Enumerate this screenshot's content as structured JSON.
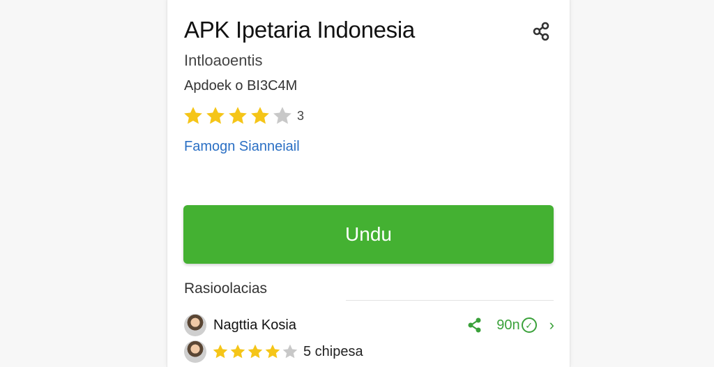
{
  "app": {
    "title": "APK Ipetaria Indonesia",
    "subtitle": "Intloaoentis",
    "meta": "Apdoek o BI3C4M",
    "rating_stars": 4,
    "rating_count": "3",
    "developer_link": "Famogn Sianneiail",
    "download_label": "Undu"
  },
  "reviews_section": {
    "title": "Rasioolacias",
    "rows": [
      {
        "name": "Nagttia Kosia",
        "action_label": "90n"
      },
      {
        "name": "5 chipesa",
        "stars": 4
      }
    ]
  },
  "colors": {
    "accent_green": "#44b132",
    "link_blue": "#2a6fc4",
    "star_gold": "#f5c518",
    "star_grey": "#c8c8c8"
  },
  "icons": {
    "share_top": "share-icon",
    "row_share": "share-icon",
    "row_badge": "circle-badge-icon",
    "row_more": "chevron-right-icon"
  }
}
